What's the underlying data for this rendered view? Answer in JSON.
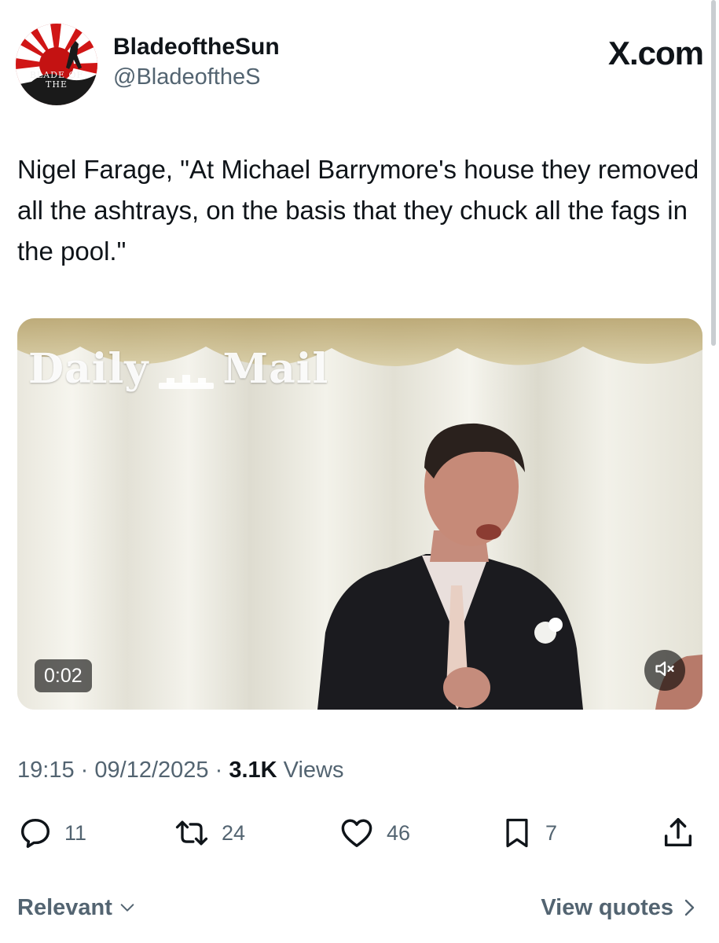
{
  "author": {
    "display_name": "BladeoftheSun",
    "handle": "@BladeoftheS",
    "avatar_text": "BLADE OF THE"
  },
  "brand": "X.com",
  "tweet": {
    "text": "Nigel Farage, \"At Michael Barrymore's house they removed all the ashtrays, on the basis that they chuck all the fags in the pool.\""
  },
  "media": {
    "watermark_left": "Daily",
    "watermark_right": "Mail",
    "duration": "0:02",
    "mute_icon": "volume-muted-icon"
  },
  "meta": {
    "time": "19:15",
    "sep1": "·",
    "date": "09/12/2025",
    "sep2": "·",
    "views_count": "3.1K",
    "views_label": "Views"
  },
  "actions": {
    "replies": "11",
    "reposts": "24",
    "likes": "46",
    "bookmarks": "7"
  },
  "footer": {
    "sort_label": "Relevant",
    "view_quotes_label": "View quotes"
  },
  "colors": {
    "text": "#0f1419",
    "secondary": "#536471",
    "avatar_red": "#b31212"
  }
}
